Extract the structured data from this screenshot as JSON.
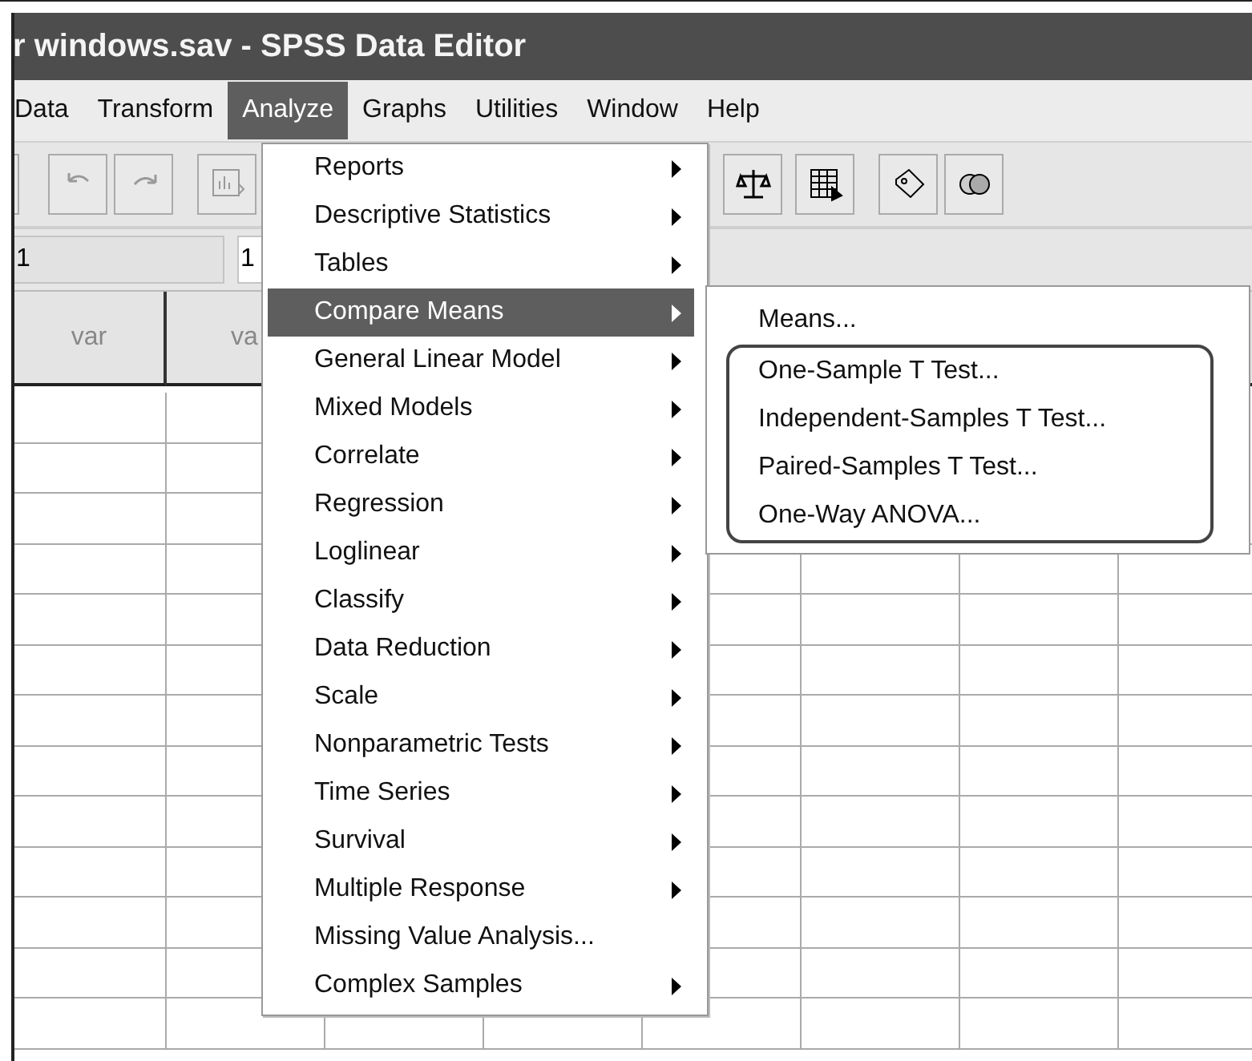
{
  "window": {
    "title": "r windows.sav - SPSS Data Editor"
  },
  "menu_bar": [
    {
      "label": "Data",
      "selected": false
    },
    {
      "label": "Transform",
      "selected": false
    },
    {
      "label": "Analyze",
      "selected": true
    },
    {
      "label": "Graphs",
      "selected": false
    },
    {
      "label": "Utilities",
      "selected": false
    },
    {
      "label": "Window",
      "selected": false
    },
    {
      "label": "Help",
      "selected": false
    }
  ],
  "cell_fields": [
    "1",
    "1"
  ],
  "grid": {
    "columns": [
      "var",
      "va"
    ]
  },
  "analyze_menu": [
    {
      "label": "Reports",
      "submenu": true,
      "selected": false
    },
    {
      "label": "Descriptive Statistics",
      "submenu": true,
      "selected": false
    },
    {
      "label": "Tables",
      "submenu": true,
      "selected": false
    },
    {
      "label": "Compare Means",
      "submenu": true,
      "selected": true
    },
    {
      "label": "General Linear Model",
      "submenu": true,
      "selected": false
    },
    {
      "label": "Mixed Models",
      "submenu": true,
      "selected": false
    },
    {
      "label": "Correlate",
      "submenu": true,
      "selected": false
    },
    {
      "label": "Regression",
      "submenu": true,
      "selected": false
    },
    {
      "label": "Loglinear",
      "submenu": true,
      "selected": false
    },
    {
      "label": "Classify",
      "submenu": true,
      "selected": false
    },
    {
      "label": "Data Reduction",
      "submenu": true,
      "selected": false
    },
    {
      "label": "Scale",
      "submenu": true,
      "selected": false
    },
    {
      "label": "Nonparametric Tests",
      "submenu": true,
      "selected": false
    },
    {
      "label": "Time Series",
      "submenu": true,
      "selected": false
    },
    {
      "label": "Survival",
      "submenu": true,
      "selected": false
    },
    {
      "label": "Multiple Response",
      "submenu": true,
      "selected": false
    },
    {
      "label": "Missing Value Analysis...",
      "submenu": false,
      "selected": false
    },
    {
      "label": "Complex Samples",
      "submenu": true,
      "selected": false
    }
  ],
  "compare_means_menu": [
    {
      "label": "Means...",
      "circled": false
    },
    {
      "label": "One-Sample T Test...",
      "circled": true
    },
    {
      "label": "Independent-Samples T Test...",
      "circled": true
    },
    {
      "label": "Paired-Samples T Test...",
      "circled": true
    },
    {
      "label": "One-Way ANOVA...",
      "circled": true
    }
  ]
}
